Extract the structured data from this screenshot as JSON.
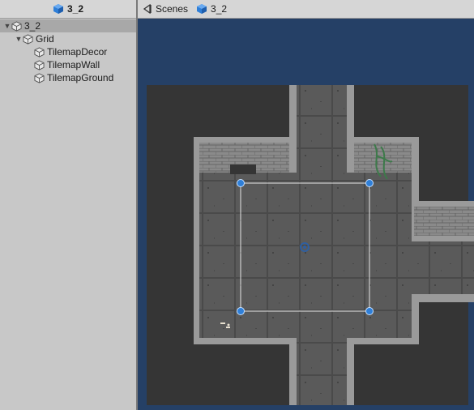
{
  "hierarchy": {
    "tab_title": "3_2",
    "items": [
      {
        "label": "3_2",
        "indent": 0,
        "expanded": true,
        "selected": true
      },
      {
        "label": "Grid",
        "indent": 1,
        "expanded": true,
        "selected": false
      },
      {
        "label": "TilemapDecor",
        "indent": 2,
        "expanded": null,
        "selected": false
      },
      {
        "label": "TilemapWall",
        "indent": 2,
        "expanded": null,
        "selected": false
      },
      {
        "label": "TilemapGround",
        "indent": 2,
        "expanded": null,
        "selected": false
      }
    ]
  },
  "scene": {
    "breadcrumb_root": "Scenes",
    "breadcrumb_current": "3_2"
  },
  "colors": {
    "accent_blue": "#2f7fd8",
    "scene_background": "#254066",
    "selection_row": "#a8a8a8"
  },
  "icons": {
    "scene": "unity-cube-icon",
    "gameobject": "gameobject-icon",
    "back": "back-arrow-icon"
  }
}
